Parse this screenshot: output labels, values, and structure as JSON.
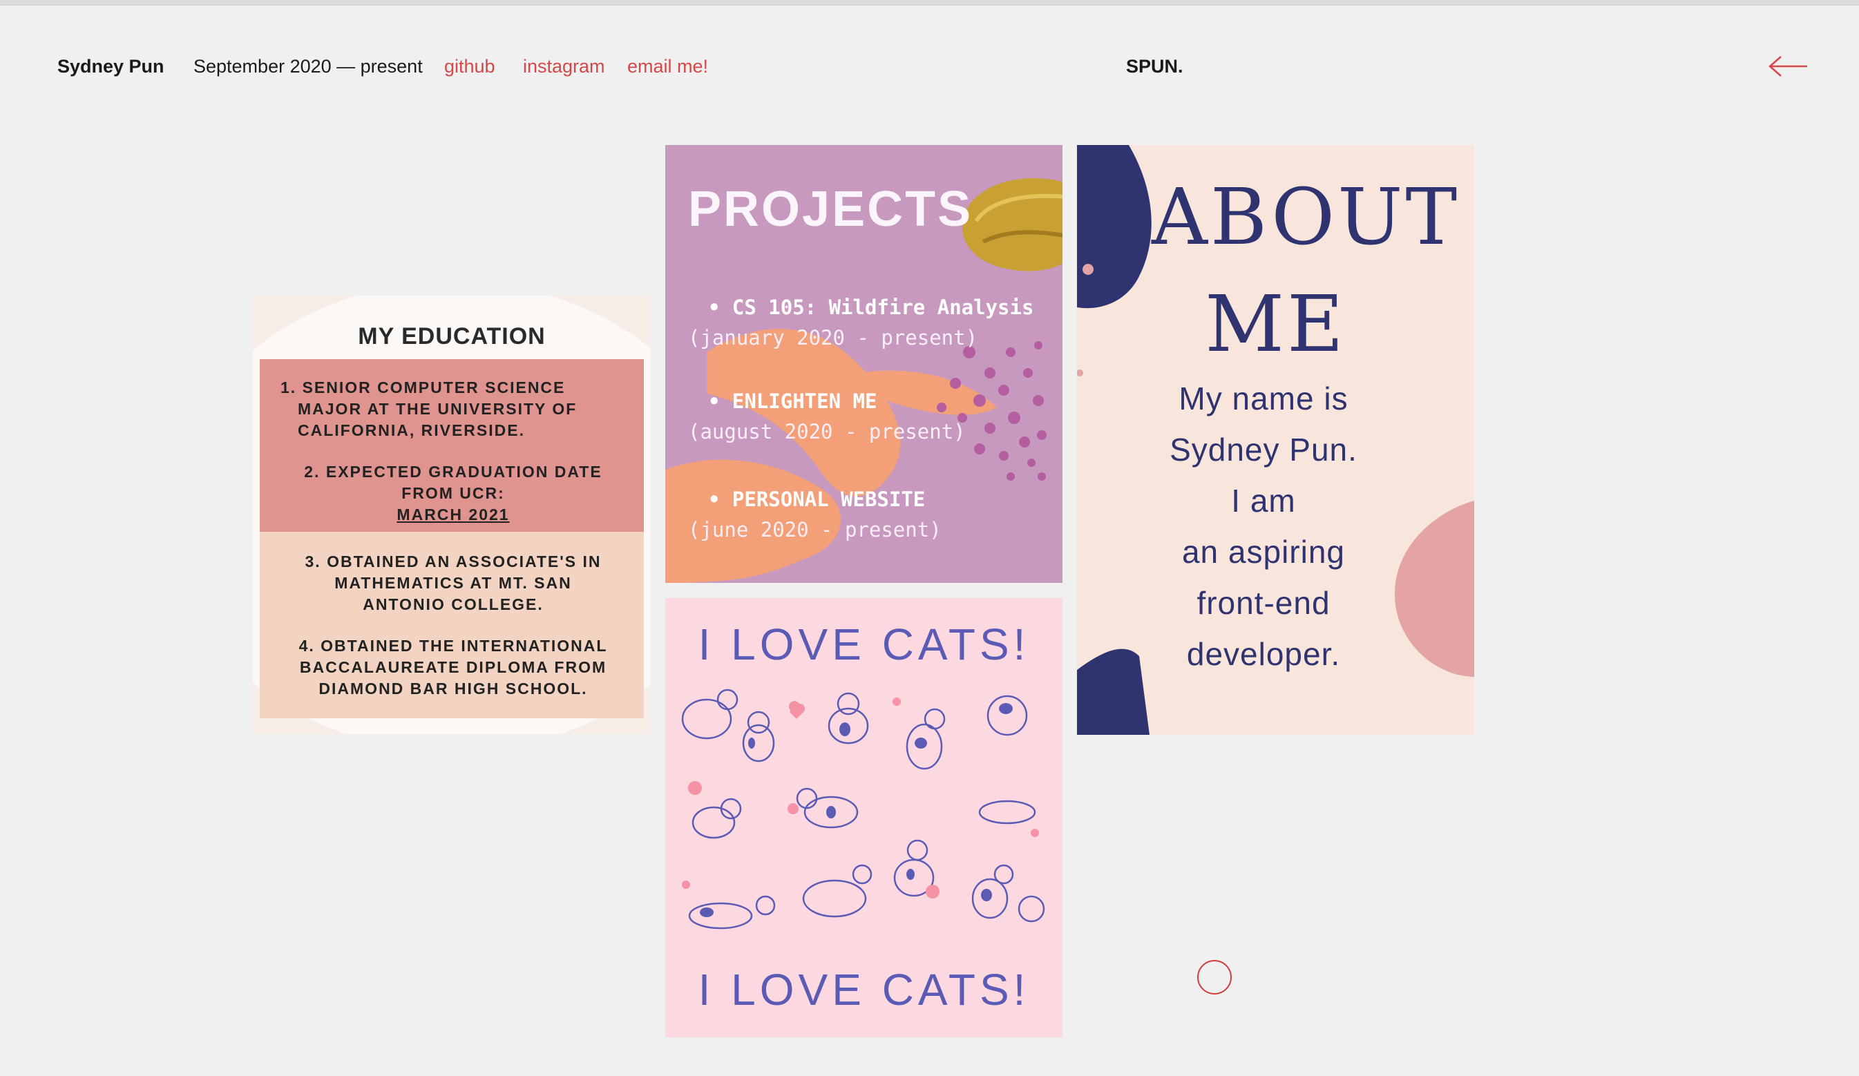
{
  "header": {
    "name": "Sydney Pun",
    "date_range": "September 2020 — present",
    "links": [
      "github",
      "instagram",
      "email me!"
    ],
    "brand": "SPUN.",
    "back_icon": "arrow-left-icon"
  },
  "colors": {
    "background": "#f0f0f0",
    "link": "#d34848",
    "navy": "#2f3370",
    "projects_bg": "#c799bf",
    "cats_bg": "#fcd8e0",
    "about_bg": "#f8e6dc"
  },
  "education": {
    "title": "MY EDUCATION",
    "items": [
      [
        "1. SENIOR COMPUTER SCIENCE",
        "MAJOR AT THE UNIVERSITY OF",
        "CALIFORNIA, RIVERSIDE."
      ],
      [
        "2. EXPECTED GRADUATION DATE",
        "FROM UCR:",
        "MARCH 2021"
      ],
      [
        "3. OBTAINED AN ASSOCIATE'S IN",
        "MATHEMATICS AT MT. SAN",
        "ANTONIO COLLEGE."
      ],
      [
        "4. OBTAINED THE INTERNATIONAL",
        "BACCALAUREATE DIPLOMA FROM",
        "DIAMOND BAR HIGH SCHOOL."
      ]
    ]
  },
  "projects": {
    "title": "PROJECTS",
    "list": [
      {
        "name": "• CS 105: Wildfire Analysis",
        "dates": "(january 2020 - present)"
      },
      {
        "name": "• ENLIGHTEN ME",
        "dates": "(august 2020 - present)"
      },
      {
        "name": "• PERSONAL WEBSITE",
        "dates": "(june 2020 - present)"
      }
    ]
  },
  "cats": {
    "heading_top": "I LOVE CATS!",
    "heading_bottom": "I LOVE CATS!"
  },
  "about": {
    "title_line1": "ABOUT",
    "title_line2": "ME",
    "bio_lines": [
      "My name is",
      "Sydney Pun.",
      "I am",
      "an aspiring",
      "front-end",
      "developer."
    ]
  }
}
